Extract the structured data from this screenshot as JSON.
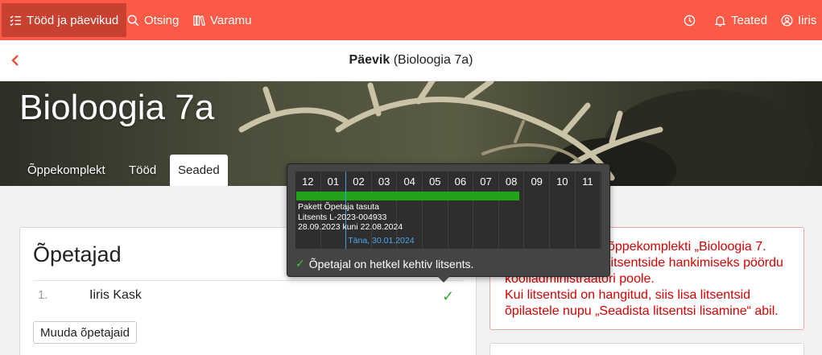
{
  "nav": {
    "works_label": "Tööd ja päevikud",
    "search_label": "Otsing",
    "library_label": "Varamu",
    "notifications_label": "Teated",
    "user_label": "Iiris"
  },
  "subheader": {
    "title_bold": "Päevik",
    "title_rest": " (Bioloogia 7a)"
  },
  "course": {
    "title": "Bioloogia 7a",
    "tabs": [
      "Õppekomplekt",
      "Tööd",
      "Seaded"
    ],
    "active_tab": "Seaded"
  },
  "teachers": {
    "heading": "Õpetajad",
    "rows": [
      {
        "num": "1.",
        "name": "Iiris Kask",
        "status": "✓"
      }
    ],
    "change_button": "Muuda õpetajaid"
  },
  "alert": {
    "line1": "õppekomplekti „Bioloogia 7.",
    "line2": "litsentside hankimiseks pöördu",
    "line3": "kooliadministraatori poole.",
    "line4": "Kui litsentsid on hangitud, siis lisa litsentsid",
    "line5": "õpilastele nupu „Seadista litsentsi lisamine“ abil."
  },
  "tooltip": {
    "months": [
      "12",
      "01",
      "02",
      "03",
      "04",
      "05",
      "06",
      "07",
      "08",
      "09",
      "10",
      "11"
    ],
    "license_package": "Pakett Õpetaja tasuta",
    "license_id": "Litsents L-2023-004933",
    "license_period": "28.09.2023 kuni 22.08.2024",
    "today_label": "Täna, 30.01.2024",
    "status": "Õpetajal on hetkel kehtiv litsents.",
    "status_icon": "✓",
    "license_span_months": {
      "start": 0,
      "end": 8.75
    },
    "today_position_months": 1.97
  },
  "colors": {
    "brand": "#fa5a46",
    "brand_active": "#c8402f",
    "license_bar": "#21a31c",
    "today_line": "#3d9ee4",
    "alert_text": "#d40000"
  }
}
